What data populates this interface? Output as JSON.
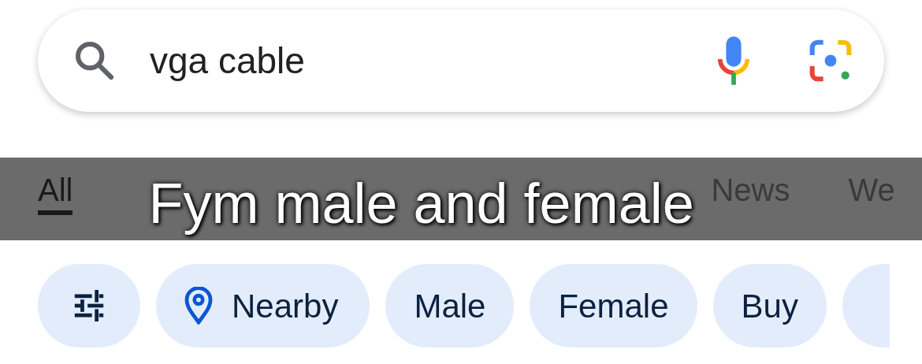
{
  "search": {
    "value": "vga cable"
  },
  "tabs": [
    {
      "label": "All",
      "selected": true
    },
    {
      "label": "News",
      "selected": false
    },
    {
      "label": "We",
      "selected": false
    }
  ],
  "caption": "Fym male and female",
  "chips": [
    {
      "kind": "filter"
    },
    {
      "kind": "place",
      "label": "Nearby"
    },
    {
      "kind": "text",
      "label": "Male"
    },
    {
      "kind": "text",
      "label": "Female"
    },
    {
      "kind": "text",
      "label": "Buy"
    },
    {
      "kind": "partial"
    }
  ]
}
